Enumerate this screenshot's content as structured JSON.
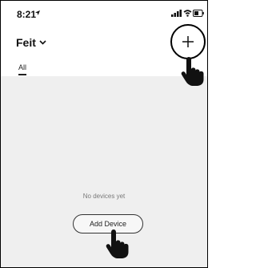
{
  "status_bar": {
    "time": "8:21",
    "icons": [
      "location-arrow-icon",
      "signal-icon",
      "wifi-icon",
      "battery-icon"
    ]
  },
  "header": {
    "home_name": "Feit",
    "add_icon": "plus-icon"
  },
  "tabs": [
    {
      "label": "All",
      "selected": true
    }
  ],
  "empty_state": {
    "message": "No devices yet",
    "button_label": "Add Device"
  },
  "annotations": [
    "hand-pointer-icon",
    "hand-pointer-icon"
  ],
  "colors": {
    "content_background": "#efefef",
    "text_primary": "#111111",
    "text_muted": "#7a7a7a"
  }
}
